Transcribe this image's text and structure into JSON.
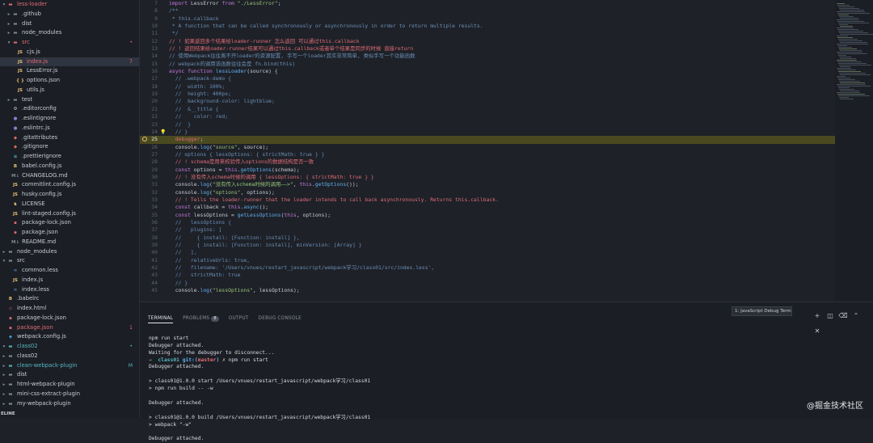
{
  "explorer": {
    "items": [
      {
        "name": "less-loader",
        "level": 0,
        "type": "folder-open",
        "status": "error"
      },
      {
        "name": ".github",
        "level": 1,
        "type": "folder"
      },
      {
        "name": "dist",
        "level": 1,
        "type": "folder"
      },
      {
        "name": "node_modules",
        "level": 1,
        "type": "folder"
      },
      {
        "name": "src",
        "level": 1,
        "type": "folder-open",
        "status": "error",
        "badge": "•"
      },
      {
        "name": "cjs.js",
        "level": 2,
        "type": "js"
      },
      {
        "name": "index.js",
        "level": 2,
        "type": "js",
        "status": "error",
        "badge": "7",
        "selected": true
      },
      {
        "name": "LessError.js",
        "level": 2,
        "type": "js"
      },
      {
        "name": "options.json",
        "level": 2,
        "type": "json"
      },
      {
        "name": "utils.js",
        "level": 2,
        "type": "js"
      },
      {
        "name": "test",
        "level": 1,
        "type": "folder"
      },
      {
        "name": ".editorconfig",
        "level": 1,
        "type": "config"
      },
      {
        "name": ".eslintignore",
        "level": 1,
        "type": "eslint"
      },
      {
        "name": ".eslintrc.js",
        "level": 1,
        "type": "eslint"
      },
      {
        "name": ".gitattributes",
        "level": 1,
        "type": "git"
      },
      {
        "name": ".gitignore",
        "level": 1,
        "type": "git"
      },
      {
        "name": ".prettierignore",
        "level": 1,
        "type": "prettier"
      },
      {
        "name": "babel.config.js",
        "level": 1,
        "type": "babel"
      },
      {
        "name": "CHANGELOG.md",
        "level": 1,
        "type": "md"
      },
      {
        "name": "commitlint.config.js",
        "level": 1,
        "type": "js"
      },
      {
        "name": "husky.config.js",
        "level": 1,
        "type": "js"
      },
      {
        "name": "LICENSE",
        "level": 1,
        "type": "license"
      },
      {
        "name": "lint-staged.config.js",
        "level": 1,
        "type": "js"
      },
      {
        "name": "package-lock.json",
        "level": 1,
        "type": "npm"
      },
      {
        "name": "package.json",
        "level": 1,
        "type": "npm"
      },
      {
        "name": "README.md",
        "level": 1,
        "type": "md"
      },
      {
        "name": "node_modules",
        "level": 0,
        "type": "folder"
      },
      {
        "name": "src",
        "level": 0,
        "type": "folder-open"
      },
      {
        "name": "common.less",
        "level": 1,
        "type": "less"
      },
      {
        "name": "index.js",
        "level": 1,
        "type": "js"
      },
      {
        "name": "index.less",
        "level": 1,
        "type": "less"
      },
      {
        "name": ".babelrc",
        "level": 0,
        "type": "babel"
      },
      {
        "name": "index.html",
        "level": 0,
        "type": "html"
      },
      {
        "name": "package-lock.json",
        "level": 0,
        "type": "npm"
      },
      {
        "name": "package.json",
        "level": 0,
        "type": "npm",
        "status": "error",
        "badge": "1"
      },
      {
        "name": "webpack.config.js",
        "level": 0,
        "type": "webpack"
      },
      {
        "name": "class02",
        "level": 0,
        "type": "folder-open",
        "status": "added",
        "badge": "•"
      },
      {
        "name": "class02",
        "level": 0,
        "type": "folder"
      },
      {
        "name": "clean-webpack-plugin",
        "level": 0,
        "type": "folder",
        "status": "added",
        "badge": "M"
      },
      {
        "name": "dist",
        "level": 0,
        "type": "folder"
      },
      {
        "name": "html-webpack-plugin",
        "level": 0,
        "type": "folder"
      },
      {
        "name": "mini-css-extract-plugin",
        "level": 0,
        "type": "folder"
      },
      {
        "name": "my-webpack-plugin",
        "level": 0,
        "type": "folder"
      }
    ],
    "footer": "ELINE"
  },
  "editor": {
    "highlight_line": 25,
    "lines": [
      {
        "n": 7,
        "t": [
          [
            "kw",
            "import"
          ],
          [
            "p",
            " LessError "
          ],
          [
            "kw",
            "from"
          ],
          [
            "p",
            " "
          ],
          [
            "str",
            "\"./LessError\""
          ],
          [
            "p",
            ";"
          ]
        ]
      },
      {
        "n": 8,
        "t": [
          [
            "com",
            "/**"
          ]
        ]
      },
      {
        "n": 9,
        "t": [
          [
            "com",
            " * this.callback"
          ]
        ]
      },
      {
        "n": 10,
        "t": [
          [
            "com",
            " * A function that can be called synchronously or asynchronously in order to return multiple results."
          ]
        ]
      },
      {
        "n": 11,
        "t": [
          [
            "com",
            " */"
          ]
        ]
      },
      {
        "n": 12,
        "t": [
          [
            "red",
            "// ! 如果返回多个结果给loader-runner 怎么返回 可以通过this.callback"
          ]
        ]
      },
      {
        "n": 13,
        "t": [
          [
            "red",
            "// ! 返回结果给oader-runner结果可以通过this.callback或者单个结果是同步的时候 直接return"
          ]
        ]
      },
      {
        "n": 14,
        "t": [
          [
            "com",
            "// 使用Webpack往往离不开loader的资源配置, 手写一个loader其实非常简单, 类似手写一个功能函数"
          ]
        ]
      },
      {
        "n": 15,
        "t": [
          [
            "com",
            "// webpack的调用该函数往往会是 fn.bind(this)"
          ]
        ]
      },
      {
        "n": 16,
        "t": [
          [
            "kw",
            "async"
          ],
          [
            "p",
            " "
          ],
          [
            "kw",
            "function"
          ],
          [
            "p",
            " "
          ],
          [
            "fn",
            "lessLoader"
          ],
          [
            "p",
            "(source) {"
          ]
        ]
      },
      {
        "n": 17,
        "t": [
          [
            "com",
            "  // .webpack-demo {"
          ]
        ]
      },
      {
        "n": 18,
        "t": [
          [
            "com",
            "  //  width: 100%;"
          ]
        ]
      },
      {
        "n": 19,
        "t": [
          [
            "com",
            "  //  height: 400px;"
          ]
        ]
      },
      {
        "n": 20,
        "t": [
          [
            "com",
            "  //  background-color: lightblue;"
          ]
        ]
      },
      {
        "n": 21,
        "t": [
          [
            "com",
            "  //  &__title {"
          ]
        ]
      },
      {
        "n": 22,
        "t": [
          [
            "com",
            "  //    color: red;"
          ]
        ]
      },
      {
        "n": 23,
        "t": [
          [
            "com",
            "  //  }"
          ]
        ]
      },
      {
        "n": 24,
        "t": [
          [
            "com",
            "  // }"
          ]
        ],
        "bulb": true
      },
      {
        "n": 25,
        "t": [
          [
            "red",
            "  debugger"
          ],
          [
            "p",
            ";"
          ]
        ],
        "bp": true
      },
      {
        "n": 26,
        "t": [
          [
            "p",
            "  console."
          ],
          [
            "fn",
            "log"
          ],
          [
            "p",
            "("
          ],
          [
            "str",
            "\"source\""
          ],
          [
            "p",
            ", source);"
          ]
        ]
      },
      {
        "n": 27,
        "t": [
          [
            "com",
            "  // options { lessOptions: { strictMath: true } }"
          ]
        ]
      },
      {
        "n": 28,
        "t": [
          [
            "red",
            "  // ! schema是用来校验传入options的数据结构是否一致"
          ]
        ]
      },
      {
        "n": 29,
        "t": [
          [
            "kw",
            "  const"
          ],
          [
            "p",
            " options = "
          ],
          [
            "kw",
            "this"
          ],
          [
            "p",
            "."
          ],
          [
            "fn",
            "getOptions"
          ],
          [
            "p",
            "(schema);"
          ]
        ]
      },
      {
        "n": 30,
        "t": [
          [
            "red",
            "  // ! 没有传入schema时候的调用 { lessOptions: { strictMath: true } }"
          ]
        ]
      },
      {
        "n": 31,
        "t": [
          [
            "p",
            "  console."
          ],
          [
            "fn",
            "log"
          ],
          [
            "p",
            "("
          ],
          [
            "str",
            "\"没有传入schema时候的调用——>\""
          ],
          [
            "p",
            ", "
          ],
          [
            "kw",
            "this"
          ],
          [
            "p",
            "."
          ],
          [
            "fn",
            "getOptions"
          ],
          [
            "p",
            "());"
          ]
        ]
      },
      {
        "n": 32,
        "t": [
          [
            "p",
            "  console."
          ],
          [
            "fn",
            "log"
          ],
          [
            "p",
            "("
          ],
          [
            "str",
            "\"options\""
          ],
          [
            "p",
            ", options);"
          ]
        ]
      },
      {
        "n": 33,
        "t": [
          [
            "red",
            "  // ! Tells the loader-runner that the loader intends to call back asynchronously. Returns this.callback."
          ]
        ]
      },
      {
        "n": 34,
        "t": [
          [
            "kw",
            "  const"
          ],
          [
            "p",
            " callback = "
          ],
          [
            "kw",
            "this"
          ],
          [
            "p",
            "."
          ],
          [
            "fn",
            "async"
          ],
          [
            "p",
            "();"
          ]
        ]
      },
      {
        "n": 35,
        "t": [
          [
            "kw",
            "  const"
          ],
          [
            "p",
            " lessOptions = "
          ],
          [
            "fn",
            "getLessOptions"
          ],
          [
            "p",
            "("
          ],
          [
            "kw",
            "this"
          ],
          [
            "p",
            ", options);"
          ]
        ]
      },
      {
        "n": 36,
        "t": [
          [
            "com",
            "  //   lessOptions {"
          ]
        ]
      },
      {
        "n": 37,
        "t": [
          [
            "com",
            "  //   plugins: ["
          ]
        ]
      },
      {
        "n": 38,
        "t": [
          [
            "com",
            "  //     { install: [Function: install] },"
          ]
        ]
      },
      {
        "n": 39,
        "t": [
          [
            "com",
            "  //     { install: [Function: install], minVersion: [Array] }"
          ]
        ]
      },
      {
        "n": 40,
        "t": [
          [
            "com",
            "  //   ],"
          ]
        ]
      },
      {
        "n": 41,
        "t": [
          [
            "com",
            "  //   relativeUrls: true,"
          ]
        ]
      },
      {
        "n": 42,
        "t": [
          [
            "com",
            "  //   filename: '/Users/vnues/restart_javascript/webpack学习/class01/src/index.less',"
          ]
        ]
      },
      {
        "n": 43,
        "t": [
          [
            "com",
            "  //   strictMath: true"
          ]
        ]
      },
      {
        "n": 44,
        "t": [
          [
            "com",
            "  // }"
          ]
        ]
      },
      {
        "n": 45,
        "t": [
          [
            "p",
            "  console."
          ],
          [
            "fn",
            "log"
          ],
          [
            "p",
            "("
          ],
          [
            "str",
            "\"lessOptions\""
          ],
          [
            "p",
            ", lessOptions);"
          ]
        ]
      }
    ]
  },
  "terminal": {
    "tabs": [
      {
        "label": "TERMINAL",
        "active": true
      },
      {
        "label": "PROBLEMS",
        "count": "8"
      },
      {
        "label": "OUTPUT"
      },
      {
        "label": "DEBUG CONSOLE"
      }
    ],
    "selector": "1: JavaScript Debug Termi",
    "actions": [
      {
        "name": "add-terminal-icon",
        "glyph": "+"
      },
      {
        "name": "split-terminal-icon",
        "glyph": "◫"
      },
      {
        "name": "trash-icon",
        "glyph": "⌫"
      },
      {
        "name": "chevron-up-icon",
        "glyph": "⌃"
      },
      {
        "name": "close-icon",
        "glyph": "✕"
      }
    ],
    "lines": [
      [],
      [
        [
          "p",
          "npm run start"
        ]
      ],
      [
        [
          "p",
          "Debugger attached."
        ]
      ],
      [
        [
          "p",
          "Waiting for the debugger to disconnect..."
        ]
      ],
      [
        [
          "arrow",
          "→  "
        ],
        [
          "cyan",
          "class01"
        ],
        [
          "p",
          " "
        ],
        [
          "blue",
          "git:("
        ],
        [
          "redb",
          "master"
        ],
        [
          "blue",
          ")"
        ],
        [
          "p",
          " "
        ],
        [
          "yel",
          "✗"
        ],
        [
          "p",
          " npm run start"
        ]
      ],
      [
        [
          "p",
          "Debugger attached."
        ]
      ],
      [],
      [
        [
          "p",
          "> class01@1.0.0 start /Users/vnues/restart_javascript/webpack学习/class01"
        ]
      ],
      [
        [
          "p",
          "> npm run build -- -w"
        ]
      ],
      [],
      [
        [
          "p",
          "Debugger attached."
        ]
      ],
      [],
      [
        [
          "p",
          "> class01@1.0.0 build /Users/vnues/restart_javascript/webpack学习/class01"
        ]
      ],
      [
        [
          "p",
          "> webpack \"-w\""
        ]
      ],
      [],
      [
        [
          "p",
          "Debugger attached."
        ]
      ]
    ],
    "watermark": "@掘金技术社区"
  }
}
